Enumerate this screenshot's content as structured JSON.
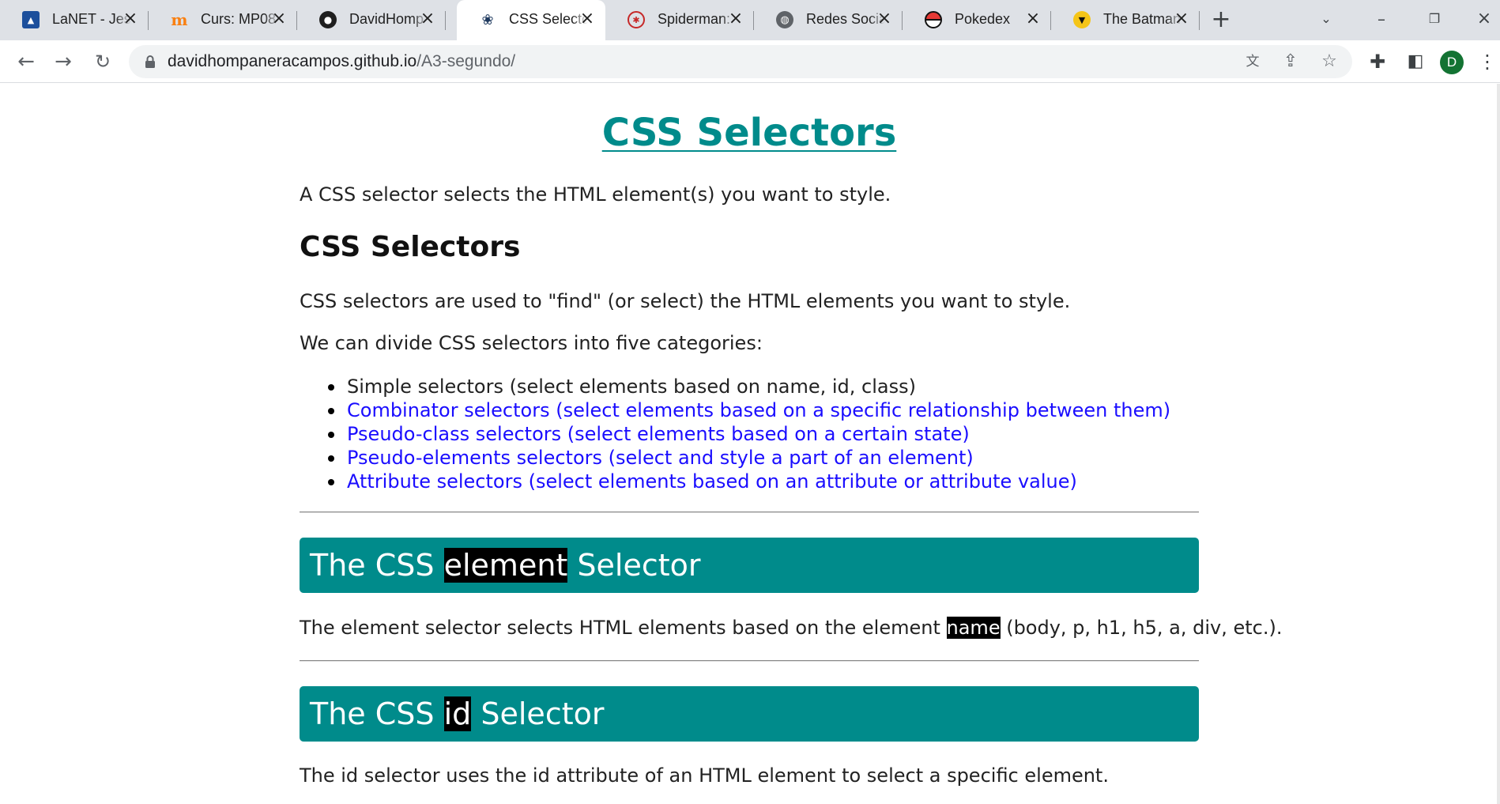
{
  "browser": {
    "tabs": [
      {
        "title": "LaNET - Jes",
        "icon": "lanet-favicon",
        "active": false
      },
      {
        "title": "Curs: MP08",
        "icon": "moodle-favicon",
        "active": false
      },
      {
        "title": "DavidHomp",
        "icon": "github-favicon",
        "active": false
      },
      {
        "title": "CSS Selecto",
        "icon": "paw-favicon",
        "active": true
      },
      {
        "title": "Spiderman:",
        "icon": "spiderman-favicon",
        "active": false
      },
      {
        "title": "Redes Socia",
        "icon": "globe-favicon",
        "active": false
      },
      {
        "title": "Pokedex",
        "icon": "pokeball-favicon",
        "active": false
      },
      {
        "title": "The Batman",
        "icon": "batman-favicon",
        "active": false
      }
    ],
    "url_host": "davidhompaneracampos.github.io",
    "url_path": "/A3-segundo/",
    "profile_initial": "D"
  },
  "page": {
    "title": "CSS Selectors",
    "intro": "A CSS selector selects the HTML element(s) you want to style.",
    "section_heading": "CSS Selectors",
    "p1": "CSS selectors are used to \"find\" (or select) the HTML elements you want to style.",
    "p2": "We can divide CSS selectors into five categories:",
    "categories": [
      {
        "text": "Simple selectors (select elements based on name, id, class)",
        "link": false
      },
      {
        "text": "Combinator selectors (select elements based on a specific relationship between them)",
        "link": true
      },
      {
        "text": "Pseudo-class selectors (select elements based on a certain state)",
        "link": true
      },
      {
        "text": "Pseudo-elements selectors (select and style a part of an element)",
        "link": true
      },
      {
        "text": "Attribute selectors (select elements based on an attribute or attribute value)",
        "link": true
      }
    ],
    "element_section": {
      "heading_pre": "The CSS ",
      "heading_hl": "element",
      "heading_post": " Selector",
      "text_pre": "The element selector selects HTML elements based on the element ",
      "text_hl": "name",
      "text_post": " (body, p, h1, h5, a, div, etc.)."
    },
    "id_section": {
      "heading_pre": "The CSS ",
      "heading_hl": "id",
      "heading_post": " Selector",
      "text": "The id selector uses the id attribute of an HTML element to select a specific element."
    }
  },
  "colors": {
    "accent": "#008b8b",
    "link": "#1a0dff",
    "highlight_bg": "#000000"
  }
}
